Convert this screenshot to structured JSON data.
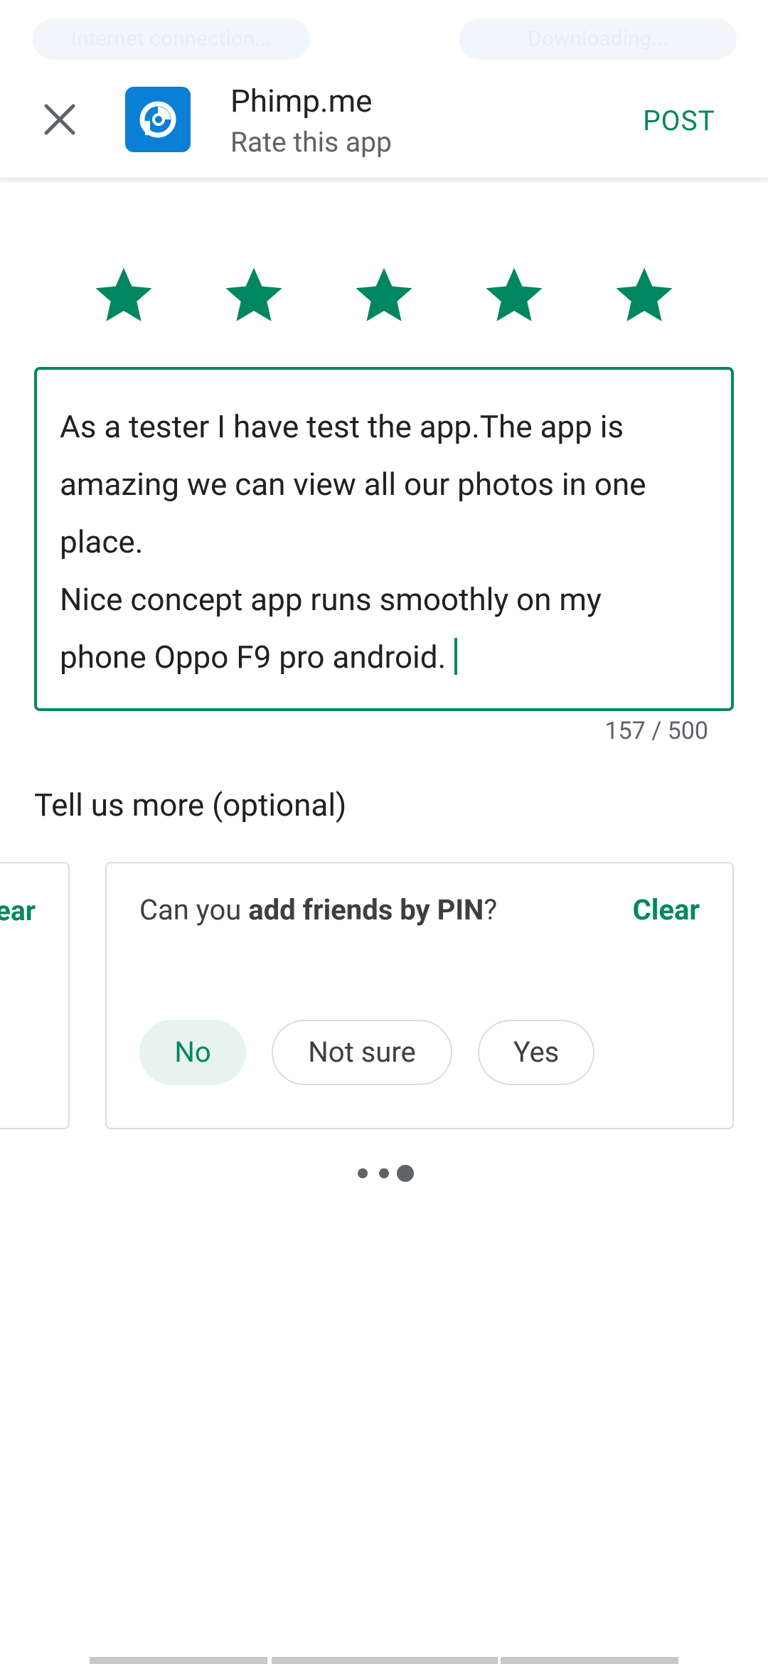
{
  "status_bar": {
    "left_text": "Internet connection...",
    "right_text": "Downloading..."
  },
  "header": {
    "app_name": "Phimp.me",
    "subtitle": "Rate this app",
    "post_label": "POST",
    "close_icon": "close-icon",
    "app_icon": "phimpme-logo-icon"
  },
  "rating": {
    "value": 5,
    "max": 5,
    "star_color": "#01875f"
  },
  "review": {
    "text": "As a tester I have test the app.The app is\namazing we can view all our photos in one\nplace.\nNice concept app runs smoothly on my\nphone Oppo F9 pro android.",
    "char_count": "157 / 500"
  },
  "tell_more": {
    "title": "Tell us more (optional)",
    "prev_card_clear": "ear",
    "question_prefix": "Can you ",
    "question_bold": "add friends by PIN",
    "question_suffix": "?",
    "clear_label": "Clear",
    "options": [
      "No",
      "Not sure",
      "Yes"
    ],
    "selected": "No"
  },
  "pager": {
    "count": 3,
    "active_index": 2
  },
  "colors": {
    "accent": "#01875f",
    "text_primary": "#202124",
    "text_secondary": "#5f6368",
    "chip_selected_bg": "#e6f3ef",
    "app_icon_bg": "#0a7fd6"
  }
}
